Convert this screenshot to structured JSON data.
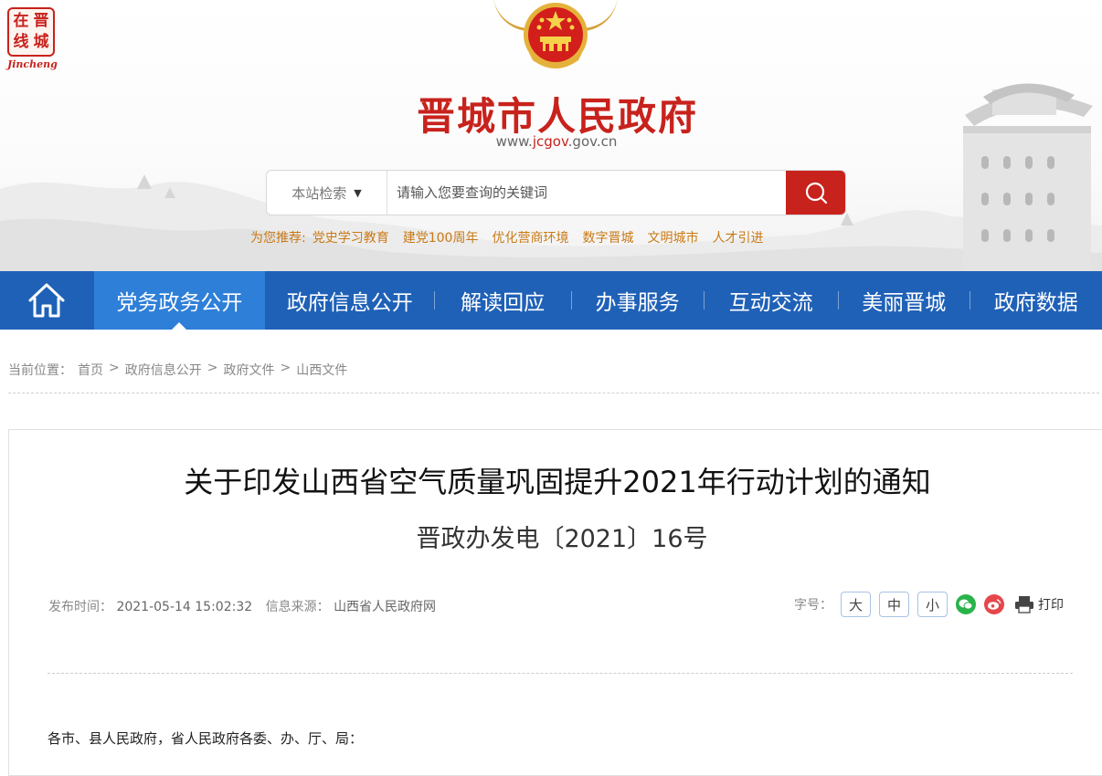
{
  "header": {
    "logo_chars": [
      "在",
      "晋",
      "线",
      "城"
    ],
    "logo_en": "Jincheng",
    "site_title": "晋城市人民政府",
    "site_url_prefix": "www.",
    "site_url_strong": "jcgov",
    "site_url_suffix": ".gov.cn"
  },
  "search": {
    "scope_label": "本站检索",
    "placeholder": "请输入您要查询的关键词"
  },
  "recommend": {
    "lead": "为您推荐:",
    "links": [
      "党史学习教育",
      "建党100周年",
      "优化营商环境",
      "数字晋城",
      "文明城市",
      "人才引进"
    ]
  },
  "nav": {
    "items": [
      {
        "label": "党务政务公开",
        "active": true
      },
      {
        "label": "政府信息公开",
        "active": false
      },
      {
        "label": "解读回应",
        "active": false
      },
      {
        "label": "办事服务",
        "active": false
      },
      {
        "label": "互动交流",
        "active": false
      },
      {
        "label": "美丽晋城",
        "active": false
      },
      {
        "label": "政府数据",
        "active": false
      }
    ]
  },
  "breadcrumb": {
    "lead": "当前位置：",
    "items": [
      "首页",
      "政府信息公开",
      "政府文件",
      "山西文件"
    ],
    "separator": ">"
  },
  "article": {
    "title": "关于印发山西省空气质量巩固提升2021年行动计划的通知",
    "doc_number": "晋政办发电〔2021〕16号",
    "publish_label": "发布时间：",
    "publish_time": "2021-05-14 15:02:32",
    "source_label": "信息来源：",
    "source": "山西省人民政府网",
    "font_label": "字号：",
    "font_sizes": [
      "大",
      "中",
      "小"
    ],
    "print_label": "打印",
    "salutation": "各市、县人民政府，省人民政府各委、办、厅、局："
  },
  "colors": {
    "brand_red": "#c8221c",
    "nav_blue": "#1f61b7",
    "nav_active": "#2e7fd8",
    "recommend_orange": "#c97a16"
  }
}
